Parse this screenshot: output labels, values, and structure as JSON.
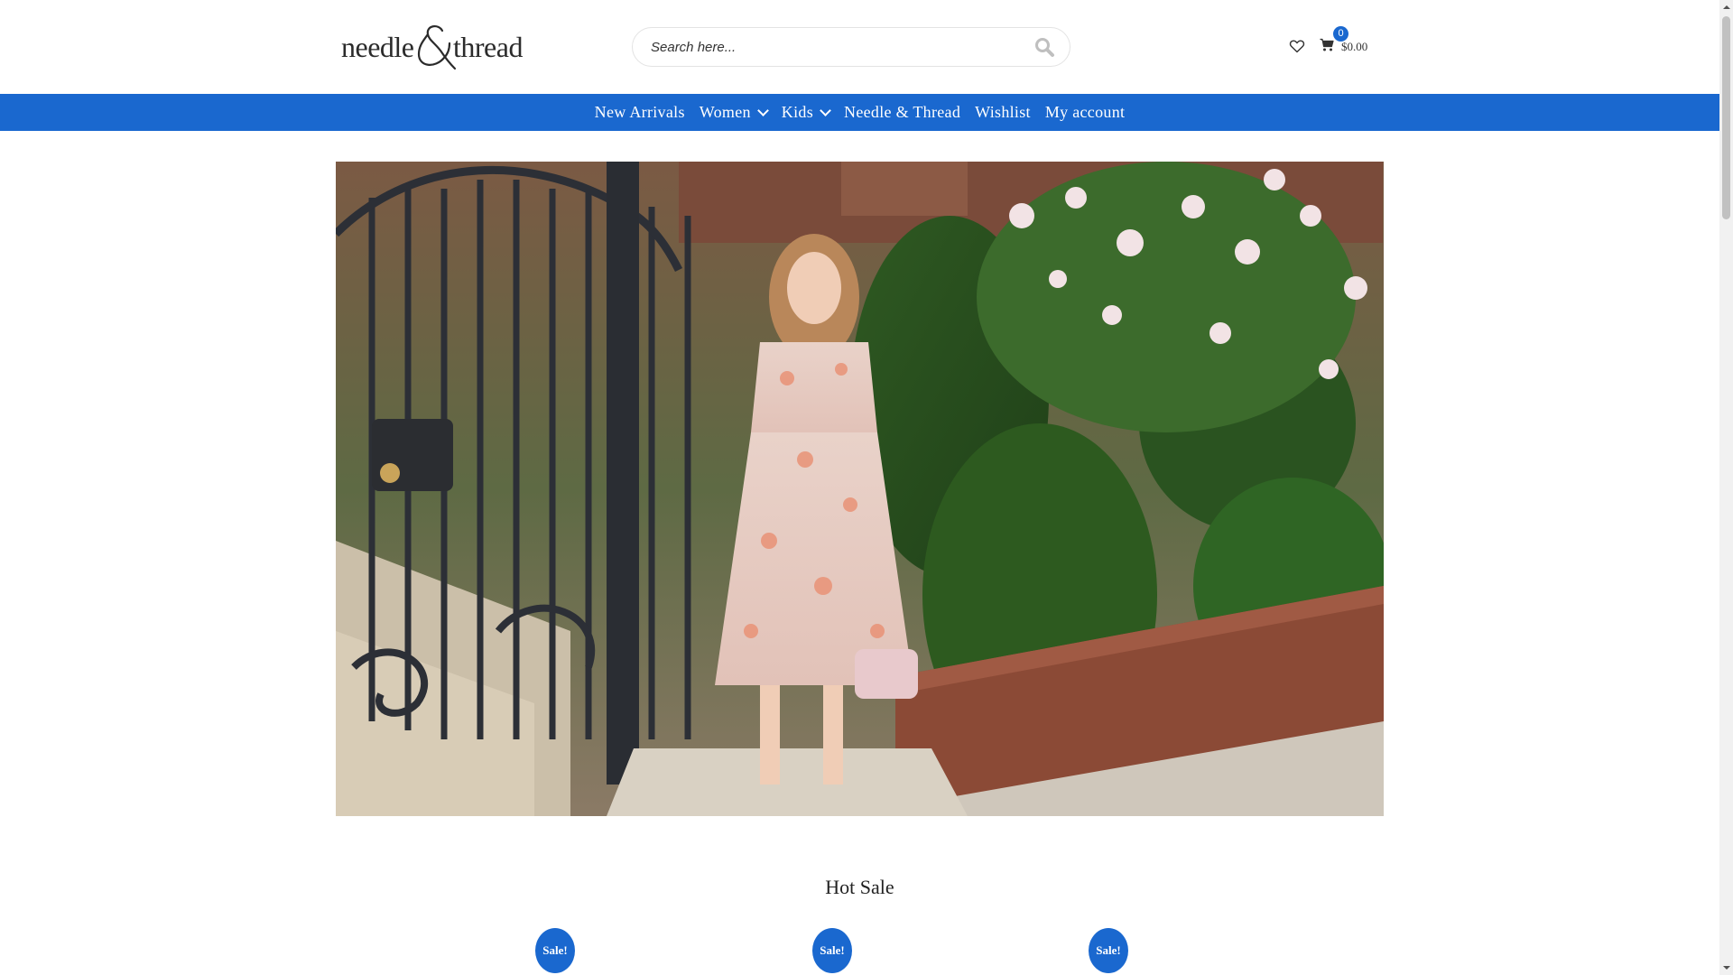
{
  "brand": {
    "logo_part1": "needle",
    "logo_part2": "thread"
  },
  "search": {
    "placeholder": "Search here..."
  },
  "header": {
    "cart_count": "0",
    "cart_total": "$0.00"
  },
  "nav": {
    "items": [
      {
        "label": "New Arrivals"
      },
      {
        "label": "Women"
      },
      {
        "label": "Kids"
      },
      {
        "label": "Needle & Thread"
      },
      {
        "label": "Wishlist"
      },
      {
        "label": "My account"
      }
    ]
  },
  "sections": {
    "hot_sale_title": "Hot Sale"
  },
  "badges": [
    {
      "label": "Sale!"
    },
    {
      "label": "Sale!"
    },
    {
      "label": "Sale!"
    }
  ],
  "colors": {
    "accent": "#1a68cf"
  }
}
